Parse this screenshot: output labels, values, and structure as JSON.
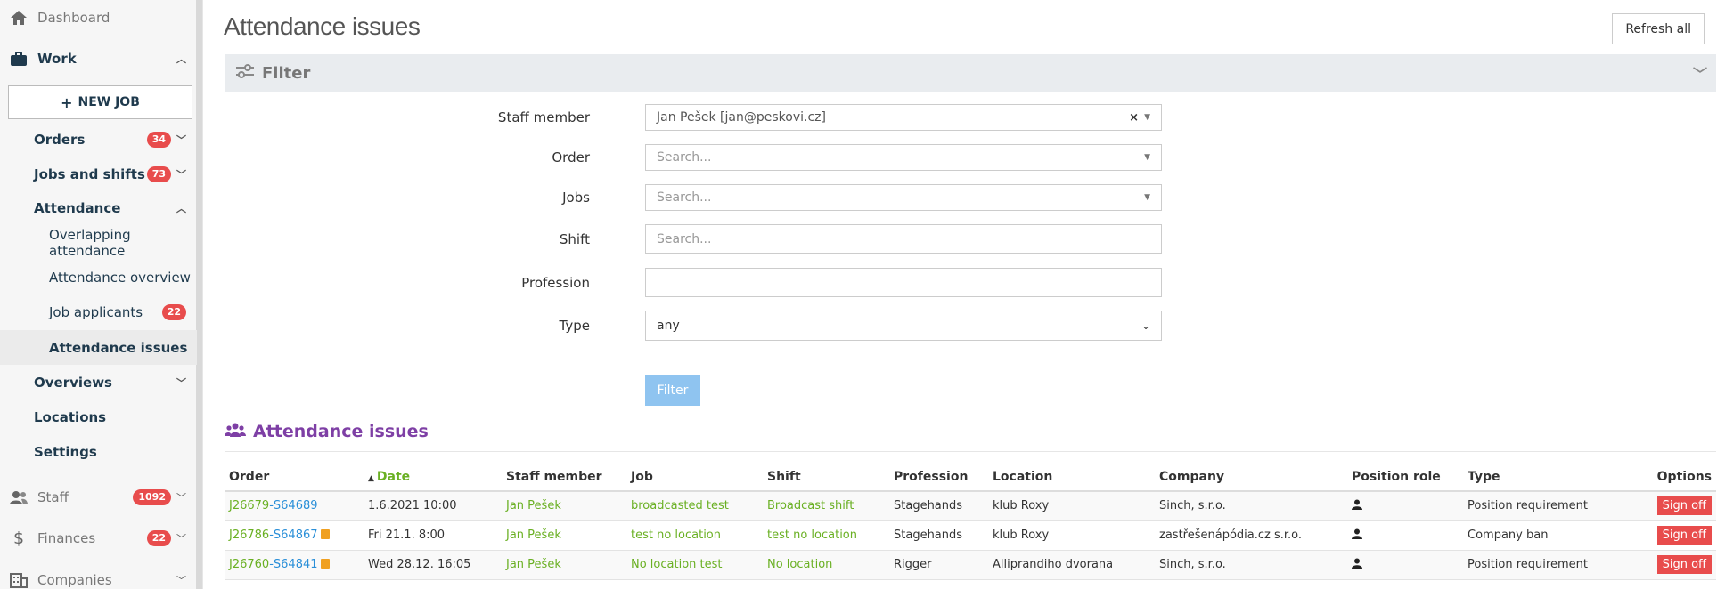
{
  "sidebar": {
    "dashboard": "Dashboard",
    "work": "Work",
    "new_job": "NEW JOB",
    "orders": {
      "label": "Orders",
      "badge": "34"
    },
    "jobs_shifts": {
      "label": "Jobs and shifts",
      "badge": "73"
    },
    "attendance": "Attendance",
    "overlapping": "Overlapping attendance",
    "overview": "Attendance overview",
    "applicants": {
      "label": "Job applicants",
      "badge": "22"
    },
    "issues": "Attendance issues",
    "overviews": "Overviews",
    "locations": "Locations",
    "settings": "Settings",
    "staff": {
      "label": "Staff",
      "badge": "1092"
    },
    "finances": {
      "label": "Finances",
      "badge": "22"
    },
    "companies": "Companies"
  },
  "header": {
    "title": "Attendance issues",
    "refresh": "Refresh all"
  },
  "filter": {
    "title": "Filter",
    "staff_label": "Staff member",
    "staff_value": "Jan Pešek [jan@peskovi.cz]",
    "order_label": "Order",
    "order_placeholder": "Search...",
    "jobs_label": "Jobs",
    "jobs_placeholder": "Search...",
    "shift_label": "Shift",
    "shift_placeholder": "Search...",
    "profession_label": "Profession",
    "profession_value": "",
    "type_label": "Type",
    "type_value": "any",
    "button": "Filter"
  },
  "issues": {
    "title": "Attendance issues",
    "columns": [
      "Order",
      "Date",
      "Staff member",
      "Job",
      "Shift",
      "Profession",
      "Location",
      "Company",
      "Position role",
      "Type",
      "Options"
    ],
    "rows": [
      {
        "job_code": "J26679",
        "shift_code": "S64689",
        "flag": false,
        "date": "1.6.2021 10:00",
        "staff": "Jan Pešek",
        "job": "broadcasted test",
        "shift": "Broadcast shift",
        "profession": "Stagehands",
        "location": "klub Roxy",
        "company": "Sinch, s.r.o.",
        "type": "Position requirement",
        "action": "Sign off"
      },
      {
        "job_code": "J26786",
        "shift_code": "S64867",
        "flag": true,
        "date": "Fri 21.1. 8:00",
        "staff": "Jan Pešek",
        "job": "test no location",
        "shift": "test no location",
        "profession": "Stagehands",
        "location": "klub Roxy",
        "company": "zastřešenápódia.cz s.r.o.",
        "type": "Company ban",
        "action": "Sign off"
      },
      {
        "job_code": "J26760",
        "shift_code": "S64841",
        "flag": true,
        "date": "Wed 28.12. 16:05",
        "staff": "Jan Pešek",
        "job": "No location test",
        "shift": "No location",
        "profession": "Rigger",
        "location": "Alliprandiho dvorana",
        "company": "Sinch, s.r.o.",
        "type": "Position requirement",
        "action": "Sign off"
      }
    ]
  },
  "colors": {
    "accent_green": "#6ab023",
    "link_blue": "#2a8fd8",
    "badge_red": "#e84c4c",
    "purple": "#7e3fa5"
  }
}
